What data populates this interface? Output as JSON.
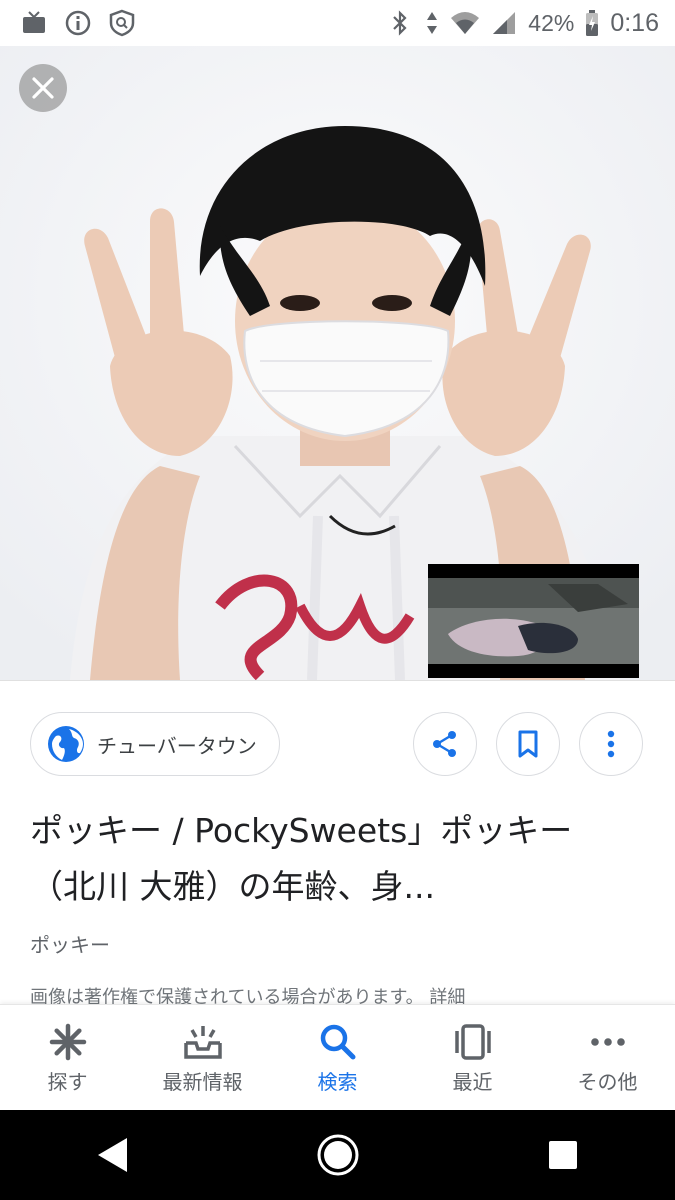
{
  "status_bar": {
    "battery": "42%",
    "time": "0:16",
    "icons": [
      "tv-icon",
      "info-icon",
      "shield-icon",
      "bluetooth-icon",
      "data-arrows-icon",
      "wifi-icon",
      "signal-icon",
      "battery-icon"
    ]
  },
  "viewer": {
    "close_icon": "close-icon"
  },
  "result": {
    "source_name": "チューバータウン",
    "title": "ポッキー / PockySweets」ポッキー（北川 大雅）の年齢、身...",
    "site": "ポッキー",
    "copyright": "画像は著作権で保護されている場合があります。 詳細"
  },
  "actions": [
    "share-icon",
    "bookmark-icon",
    "more-vert-icon"
  ],
  "bottom_nav": {
    "items": [
      {
        "label": "探す",
        "icon": "asterisk-icon"
      },
      {
        "label": "最新情報",
        "icon": "updates-icon"
      },
      {
        "label": "検索",
        "icon": "search-icon"
      },
      {
        "label": "最近",
        "icon": "recent-icon"
      },
      {
        "label": "その他",
        "icon": "more-horiz-icon"
      }
    ],
    "active_index": 2
  },
  "colors": {
    "accent": "#1a73e8",
    "text_primary": "#202124",
    "text_secondary": "#5f6368"
  }
}
